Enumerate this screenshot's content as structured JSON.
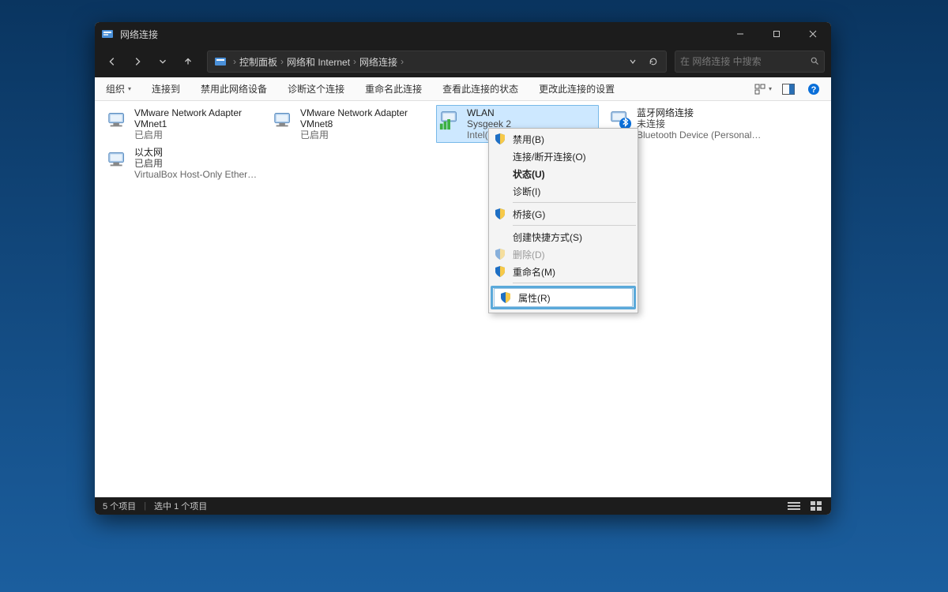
{
  "window": {
    "title": "网络连接"
  },
  "breadcrumb": {
    "items": [
      "控制面板",
      "网络和 Internet",
      "网络连接"
    ]
  },
  "search": {
    "placeholder": "在 网络连接 中搜索"
  },
  "toolbar": {
    "organize": "组织",
    "connect": "连接到",
    "disable": "禁用此网络设备",
    "diagnose": "诊断这个连接",
    "rename": "重命名此连接",
    "status": "查看此连接的状态",
    "settings": "更改此连接的设置"
  },
  "connections": [
    {
      "name": "VMware Network Adapter VMnet1",
      "line2": "",
      "line3": "已启用",
      "kind": "lan"
    },
    {
      "name": "VMware Network Adapter VMnet8",
      "line2": "",
      "line3": "已启用",
      "kind": "lan"
    },
    {
      "name": "WLAN",
      "line2": "Sysgeek 2",
      "line3": "Intel(",
      "kind": "wifi",
      "selected": true
    },
    {
      "name": "蓝牙网络连接",
      "line2": "未连接",
      "line3": "Bluetooth Device (Personal Ar...",
      "kind": "bt"
    },
    {
      "name": "以太网",
      "line2": "已启用",
      "line3": "VirtualBox Host-Only Ethernet ...",
      "kind": "lan"
    }
  ],
  "contextmenu": {
    "items": [
      {
        "label": "禁用(B)",
        "shield": true
      },
      {
        "label": "连接/断开连接(O)"
      },
      {
        "label": "状态(U)",
        "bold": true
      },
      {
        "label": "诊断(I)"
      },
      {
        "sep": true
      },
      {
        "label": "桥接(G)",
        "shield": true
      },
      {
        "sep": true
      },
      {
        "label": "创建快捷方式(S)"
      },
      {
        "label": "删除(D)",
        "shield": true,
        "disabled": true
      },
      {
        "label": "重命名(M)",
        "shield": true
      },
      {
        "sep": true
      },
      {
        "label": "属性(R)",
        "shield": true,
        "highlight": true
      }
    ]
  },
  "statusbar": {
    "total": "5 个项目",
    "selected": "选中 1 个项目"
  }
}
